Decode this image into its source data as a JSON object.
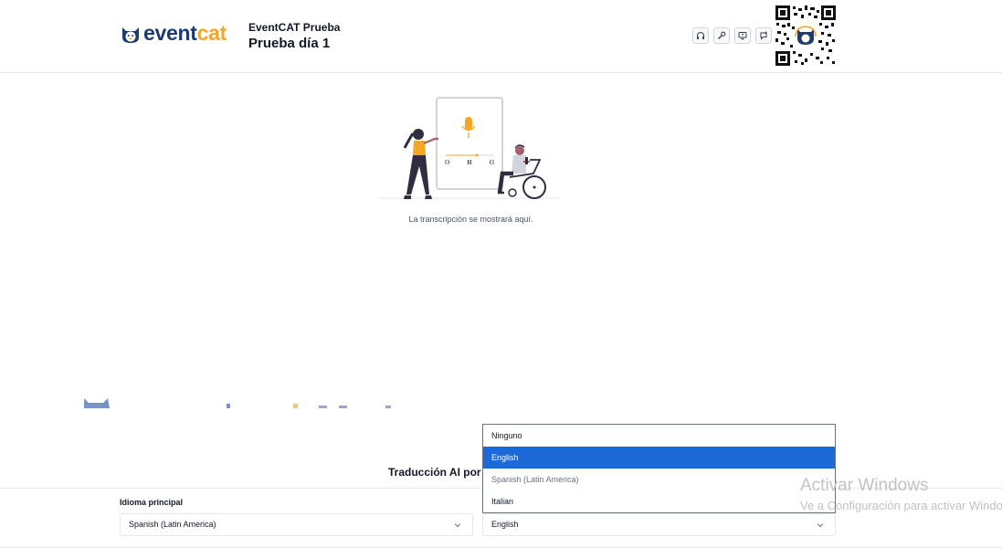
{
  "header": {
    "brand": {
      "part1": "event",
      "part2": "cat"
    },
    "event_org": "EventCAT Prueba",
    "event_name": "Prueba día 1",
    "tools": [
      {
        "icon": "headphones-icon"
      },
      {
        "icon": "wrench-icon"
      },
      {
        "icon": "screen-icon"
      },
      {
        "icon": "chat-plus-icon"
      }
    ],
    "qr_icon": "qr-code-icon"
  },
  "main": {
    "placeholder": "La transcripción se mostrará aquí."
  },
  "translation": {
    "title": "Traducción AI por",
    "primary_label": "Idioma principal",
    "primary_value": "Spanish (Latin America)",
    "secondary_value": "English",
    "options": [
      "Ninguno",
      "English",
      "Spanish (Latin America)",
      "Italian"
    ],
    "selected_index": 1
  },
  "windows_watermark": {
    "title": "Activar Windows",
    "subtitle": "Ve a Configuración para activar Windows."
  },
  "colors": {
    "brand_navy": "#1e3a6e",
    "brand_orange": "#f5a623",
    "selection_blue": "#1c6ad6"
  }
}
